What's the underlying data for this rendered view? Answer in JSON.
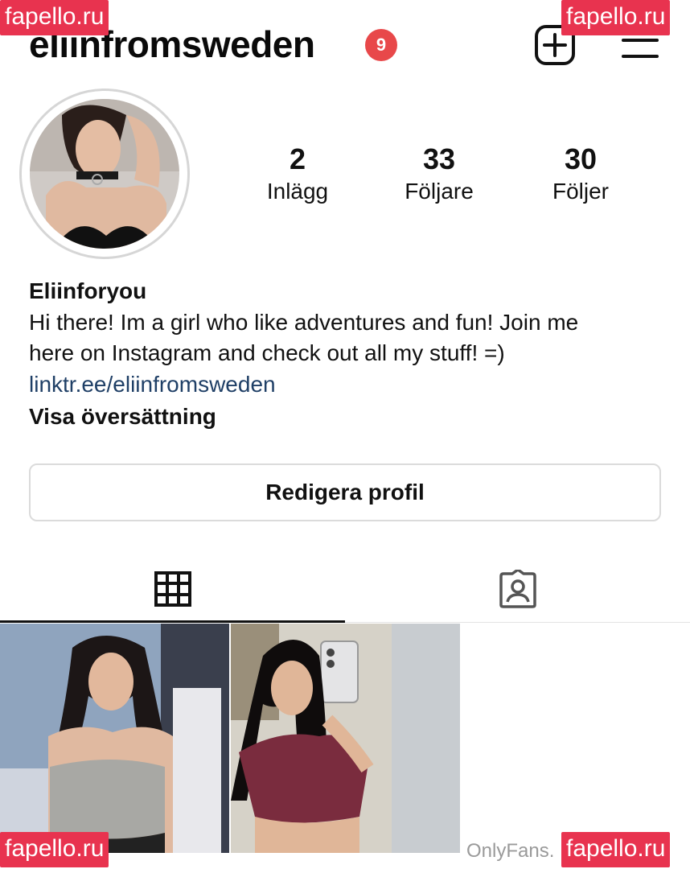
{
  "header": {
    "username": "eliinfromsweden",
    "notification_count": "9"
  },
  "stats": [
    {
      "value": "2",
      "label": "Inlägg"
    },
    {
      "value": "33",
      "label": "Följare"
    },
    {
      "value": "30",
      "label": "Följer"
    }
  ],
  "bio": {
    "name": "Eliinforyou",
    "text_line1": "Hi there! Im a girl who like adventures and fun! Join me",
    "text_line2": "here on Instagram and check out all my stuff! =)",
    "link": "linktr.ee/eliinfromsweden",
    "translate": "Visa översättning"
  },
  "edit_profile_label": "Redigera profil",
  "tabs": [
    {
      "icon": "grid-icon",
      "active": true
    },
    {
      "icon": "tagged-person-icon",
      "active": false
    }
  ],
  "watermarks": {
    "top_left": "fapello.ru",
    "top_right": "fapello.ru",
    "bottom_left": "fapello.ru",
    "bottom_right": "fapello.ru"
  },
  "footer_text": "OnlyFans.",
  "colors": {
    "badge": "#e8484a",
    "link": "#1f3f66",
    "watermark": "#e8334f"
  }
}
